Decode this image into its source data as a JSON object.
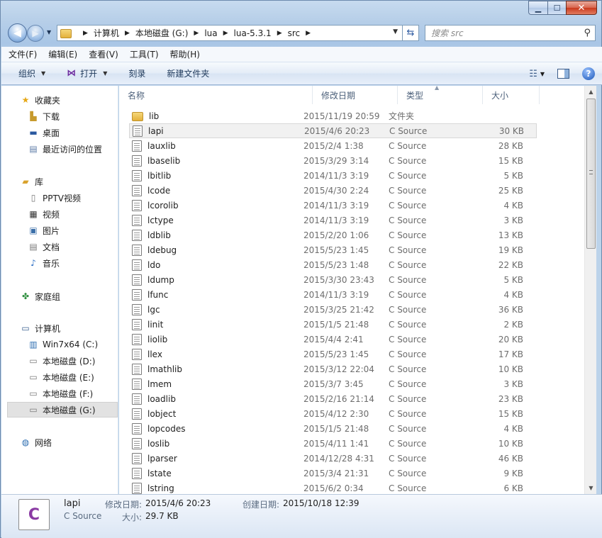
{
  "search": {
    "placeholder": "搜索 src"
  },
  "address": {
    "crumbs": [
      "计算机",
      "本地磁盘 (G:)",
      "lua",
      "lua-5.3.1",
      "src"
    ]
  },
  "menubar": {
    "items": [
      "文件(F)",
      "编辑(E)",
      "查看(V)",
      "工具(T)",
      "帮助(H)"
    ]
  },
  "toolbar": {
    "organize": "组织",
    "open": "打开",
    "burn": "刻录",
    "new_folder": "新建文件夹"
  },
  "nav": {
    "favorites": {
      "label": "收藏夹",
      "items": [
        "下载",
        "桌面",
        "最近访问的位置"
      ]
    },
    "libraries": {
      "label": "库",
      "items": [
        "PPTV视频",
        "视频",
        "图片",
        "文档",
        "音乐"
      ]
    },
    "homegroup": "家庭组",
    "computer": {
      "label": "计算机",
      "items": [
        "Win7x64 (C:)",
        "本地磁盘 (D:)",
        "本地磁盘 (E:)",
        "本地磁盘 (F:)",
        "本地磁盘 (G:)"
      ]
    },
    "network": "网络"
  },
  "columns": {
    "name": "名称",
    "date": "修改日期",
    "type": "类型",
    "size": "大小"
  },
  "files": [
    {
      "name": "lib",
      "date": "2015/11/19 20:59",
      "type": "文件夹",
      "size": "",
      "folder": true
    },
    {
      "name": "lapi",
      "date": "2015/4/6 20:23",
      "type": "C Source",
      "size": "30 KB"
    },
    {
      "name": "lauxlib",
      "date": "2015/2/4 1:38",
      "type": "C Source",
      "size": "28 KB"
    },
    {
      "name": "lbaselib",
      "date": "2015/3/29 3:14",
      "type": "C Source",
      "size": "15 KB"
    },
    {
      "name": "lbitlib",
      "date": "2014/11/3 3:19",
      "type": "C Source",
      "size": "5 KB"
    },
    {
      "name": "lcode",
      "date": "2015/4/30 2:24",
      "type": "C Source",
      "size": "25 KB"
    },
    {
      "name": "lcorolib",
      "date": "2014/11/3 3:19",
      "type": "C Source",
      "size": "4 KB"
    },
    {
      "name": "lctype",
      "date": "2014/11/3 3:19",
      "type": "C Source",
      "size": "3 KB"
    },
    {
      "name": "ldblib",
      "date": "2015/2/20 1:06",
      "type": "C Source",
      "size": "13 KB"
    },
    {
      "name": "ldebug",
      "date": "2015/5/23 1:45",
      "type": "C Source",
      "size": "19 KB"
    },
    {
      "name": "ldo",
      "date": "2015/5/23 1:48",
      "type": "C Source",
      "size": "22 KB"
    },
    {
      "name": "ldump",
      "date": "2015/3/30 23:43",
      "type": "C Source",
      "size": "5 KB"
    },
    {
      "name": "lfunc",
      "date": "2014/11/3 3:19",
      "type": "C Source",
      "size": "4 KB"
    },
    {
      "name": "lgc",
      "date": "2015/3/25 21:42",
      "type": "C Source",
      "size": "36 KB"
    },
    {
      "name": "linit",
      "date": "2015/1/5 21:48",
      "type": "C Source",
      "size": "2 KB"
    },
    {
      "name": "liolib",
      "date": "2015/4/4 2:41",
      "type": "C Source",
      "size": "20 KB"
    },
    {
      "name": "llex",
      "date": "2015/5/23 1:45",
      "type": "C Source",
      "size": "17 KB"
    },
    {
      "name": "lmathlib",
      "date": "2015/3/12 22:04",
      "type": "C Source",
      "size": "10 KB"
    },
    {
      "name": "lmem",
      "date": "2015/3/7 3:45",
      "type": "C Source",
      "size": "3 KB"
    },
    {
      "name": "loadlib",
      "date": "2015/2/16 21:14",
      "type": "C Source",
      "size": "23 KB"
    },
    {
      "name": "lobject",
      "date": "2015/4/12 2:30",
      "type": "C Source",
      "size": "15 KB"
    },
    {
      "name": "lopcodes",
      "date": "2015/1/5 21:48",
      "type": "C Source",
      "size": "4 KB"
    },
    {
      "name": "loslib",
      "date": "2015/4/11 1:41",
      "type": "C Source",
      "size": "10 KB"
    },
    {
      "name": "lparser",
      "date": "2014/12/28 4:31",
      "type": "C Source",
      "size": "46 KB"
    },
    {
      "name": "lstate",
      "date": "2015/3/4 21:31",
      "type": "C Source",
      "size": "9 KB"
    },
    {
      "name": "lstring",
      "date": "2015/6/2 0:34",
      "type": "C Source",
      "size": "6 KB"
    }
  ],
  "details": {
    "name": "lapi",
    "type": "C Source",
    "modified_label": "修改日期:",
    "modified": "2015/4/6 20:23",
    "created_label": "创建日期:",
    "created": "2015/10/18 12:39",
    "size_label": "大小:",
    "size": "29.7 KB",
    "icon_letter": "C"
  }
}
